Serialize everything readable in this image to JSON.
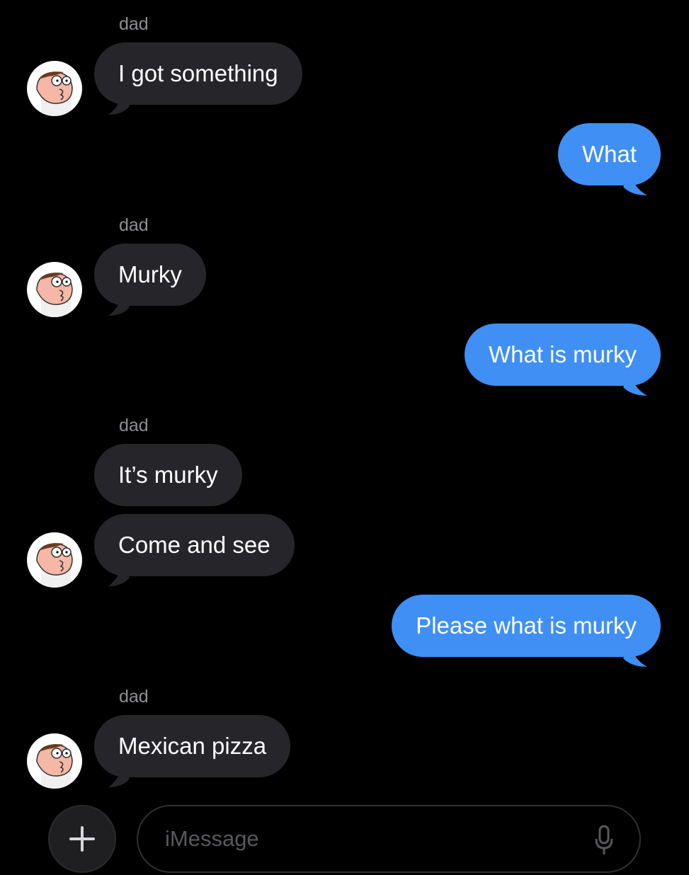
{
  "conversation": {
    "messages": [
      {
        "sender": "dad",
        "text": "I got something"
      },
      {
        "sender": "me",
        "text": "What"
      },
      {
        "sender": "dad",
        "text": "Murky"
      },
      {
        "sender": "me",
        "text": "What is murky"
      },
      {
        "sender": "dad",
        "text": "It’s murky"
      },
      {
        "sender": "dad",
        "text": "Come and see"
      },
      {
        "sender": "me",
        "text": "Please what is murky"
      },
      {
        "sender": "dad",
        "text": "Mexican pizza"
      }
    ]
  },
  "composer": {
    "placeholder": "iMessage",
    "plus_icon": "plus-icon",
    "mic_icon": "microphone-icon"
  },
  "colors": {
    "background": "#000000",
    "incoming_bubble": "#26252a",
    "outgoing_bubble": "#3f8ff5",
    "sender_label": "#8e8e93"
  }
}
